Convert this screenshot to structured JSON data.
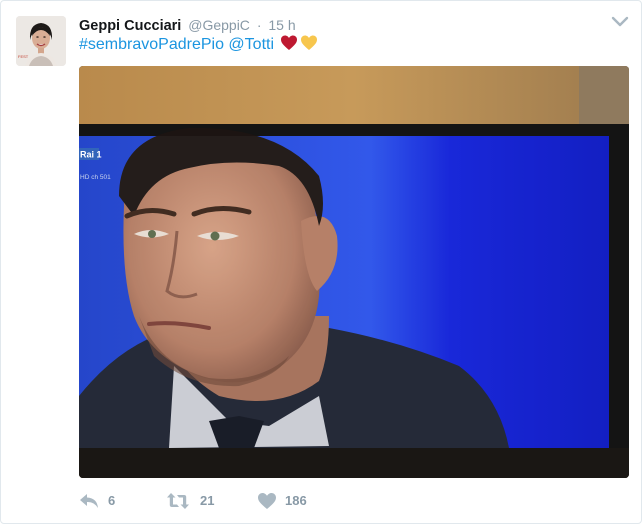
{
  "tweet": {
    "author_name": "Geppi Cucciari",
    "handle": "@GeppiC",
    "separator": "·",
    "time": "15 h",
    "text": {
      "hashtag": "#sembravoPadrePio",
      "mention": "@Totti",
      "emojis": [
        "red-heart-emoji",
        "yellow-heart-emoji"
      ]
    }
  },
  "media": {
    "channel_logo": "Rai 1",
    "channel_sub": "HD ch 501"
  },
  "actions": {
    "reply_count": "6",
    "retweet_count": "21",
    "like_count": "186"
  },
  "colors": {
    "link": "#1b95e0",
    "meta_gray": "#8899a6",
    "name": "#14171a",
    "heart_red": "#be1931",
    "heart_yellow": "#f7c64d"
  }
}
